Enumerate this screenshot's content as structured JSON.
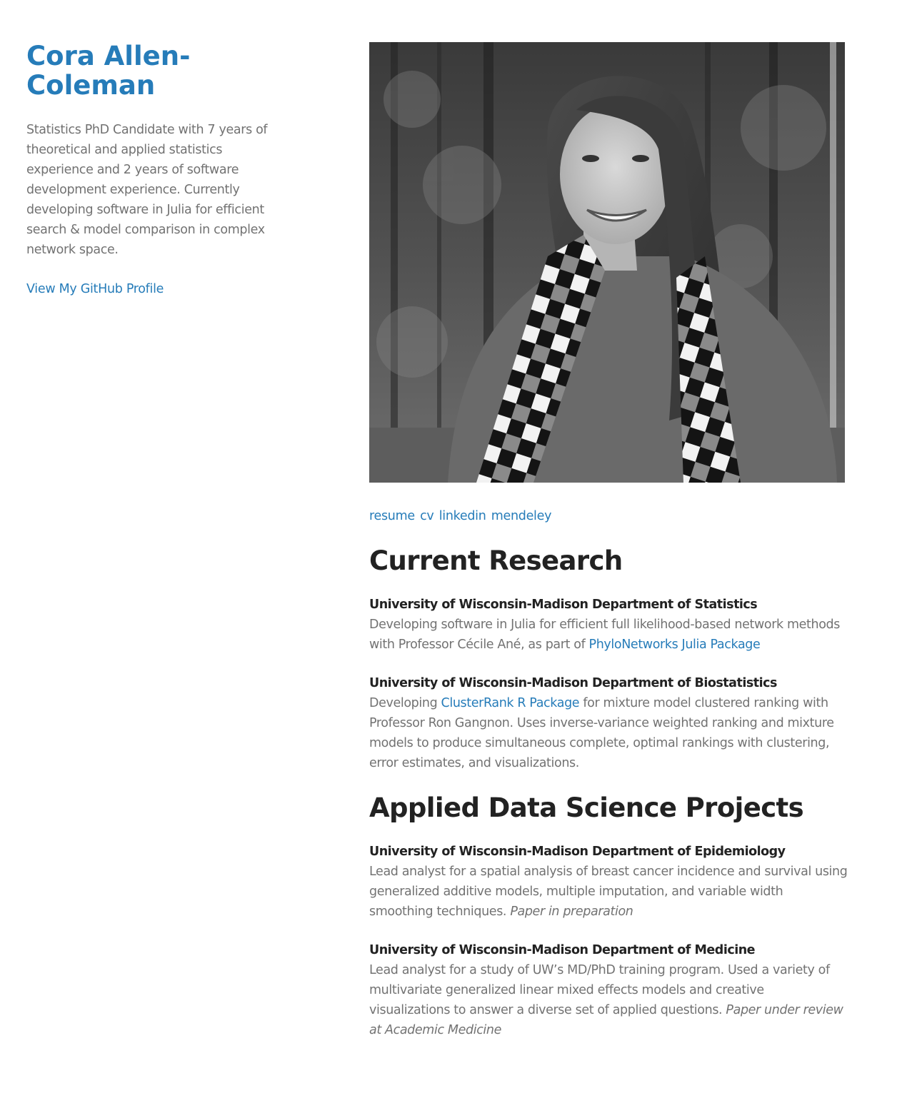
{
  "sidebar": {
    "name": "Cora Allen-Coleman",
    "tagline": "Statistics PhD Candidate with 7 years of theoretical and applied statistics experience and 2 years of software development experience. Currently developing software in Julia for efficient search & model comparison in complex network space.",
    "github_link": "View My GitHub Profile"
  },
  "photo": {
    "alt": "Portrait of Cora Allen-Coleman"
  },
  "profile_links": [
    "resume",
    "cv",
    "linkedin",
    "mendeley"
  ],
  "current_research": {
    "heading": "Current Research",
    "entries": [
      {
        "title": "University of Wisconsin-Madison Department of Statistics",
        "text_before": "Developing software in Julia for efficient full likelihood-based network methods with Professor Cécile Ané, as part of ",
        "link": "PhyloNetworks Julia Package",
        "text_after": ""
      },
      {
        "title": "University of Wisconsin-Madison Department of Biostatistics",
        "text_before": "Developing ",
        "link": "ClusterRank R Package",
        "text_after": " for mixture model clustered ranking with Professor Ron Gangnon. Uses inverse-variance weighted ranking and mixture models to produce simultaneous complete, optimal rankings with clustering, error estimates, and visualizations."
      }
    ]
  },
  "applied_projects": {
    "heading": "Applied Data Science Projects",
    "entries": [
      {
        "title": "University of Wisconsin-Madison Department of Epidemiology",
        "text": "Lead analyst for a spatial analysis of breast cancer incidence and survival using generalized additive models, multiple imputation, and variable width smoothing techniques. ",
        "note": "Paper in preparation"
      },
      {
        "title": "University of Wisconsin-Madison Department of Medicine",
        "text": "Lead analyst for a study of UW’s MD/PhD training program. Used a variety of multivariate generalized linear mixed effects models and creative visualizations to answer a diverse set of applied questions. ",
        "note": "Paper under review at Academic Medicine"
      }
    ]
  },
  "colors": {
    "link": "#267CB9",
    "heading": "#222222",
    "body_text": "#727272",
    "background": "#ffffff"
  }
}
